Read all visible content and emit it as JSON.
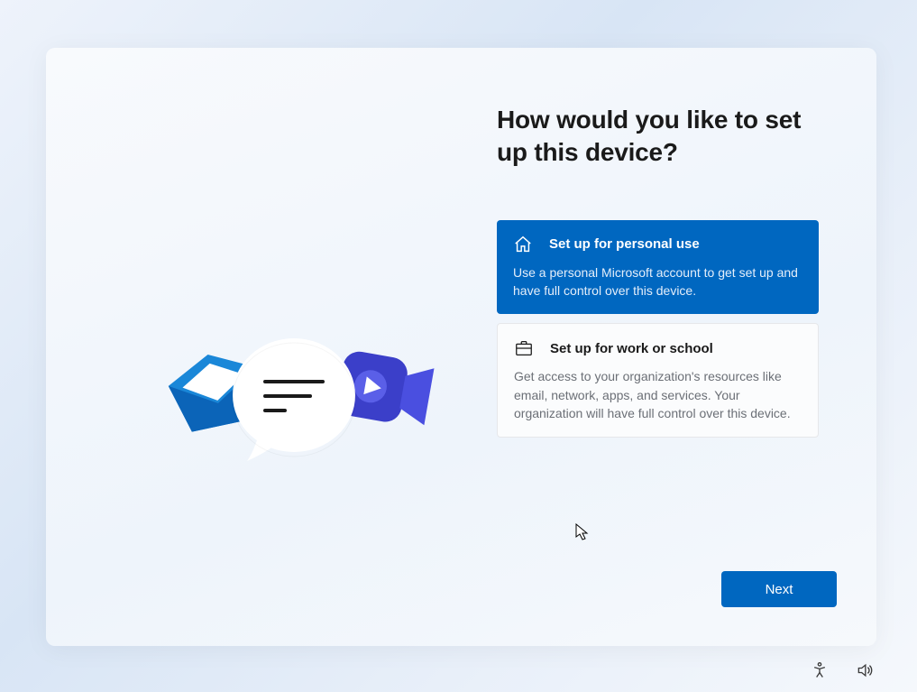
{
  "heading": "How would you like to set up this device?",
  "options": {
    "personal": {
      "title": "Set up for personal use",
      "description": "Use a personal Microsoft account to get set up and have full control over this device."
    },
    "work": {
      "title": "Set up for work or school",
      "description": "Get access to your organization's resources like email, network, apps, and services. Your organization will have full control over this device."
    }
  },
  "buttons": {
    "next": "Next"
  },
  "colors": {
    "accent": "#0067c0"
  },
  "icons": {
    "home": "home-icon",
    "briefcase": "briefcase-icon",
    "accessibility": "accessibility-icon",
    "volume": "volume-icon"
  }
}
